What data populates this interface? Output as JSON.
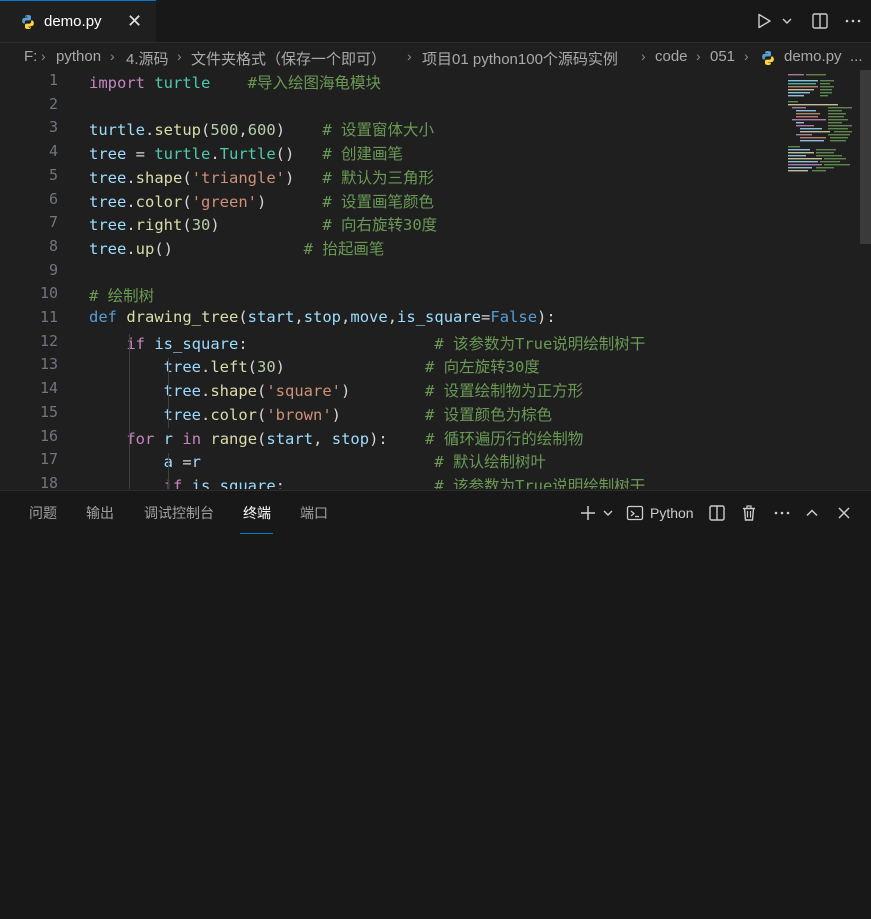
{
  "tab": {
    "title": "demo.py",
    "close": "✕"
  },
  "breadcrumb": [
    "F:",
    "python",
    "4.源码",
    "文件夹格式（保存一个即可）",
    "项目01 python100个源码实例",
    "code",
    "051",
    "demo.py",
    "..."
  ],
  "editor": {
    "line_numbers": [
      "1",
      "2",
      "3",
      "4",
      "5",
      "6",
      "7",
      "8",
      "9",
      "10",
      "11",
      "12",
      "13",
      "14",
      "15",
      "16",
      "17",
      "18"
    ],
    "lines": [
      [
        [
          "kw",
          "import"
        ],
        [
          "t",
          " "
        ],
        [
          "cls",
          "turtle"
        ],
        [
          "t",
          "    "
        ],
        [
          "cm",
          "#导入绘图海龟模块"
        ]
      ],
      [],
      [
        [
          "var",
          "turtle"
        ],
        [
          "t",
          "."
        ],
        [
          "fn",
          "setup"
        ],
        [
          "t",
          "("
        ],
        [
          "num",
          "500"
        ],
        [
          "t",
          ","
        ],
        [
          "num",
          "600"
        ],
        [
          "t",
          ")    "
        ],
        [
          "cm",
          "# 设置窗体大小"
        ]
      ],
      [
        [
          "var",
          "tree"
        ],
        [
          "t",
          " = "
        ],
        [
          "cls",
          "turtle"
        ],
        [
          "t",
          "."
        ],
        [
          "cls",
          "Turtle"
        ],
        [
          "t",
          "()   "
        ],
        [
          "cm",
          "# 创建画笔"
        ]
      ],
      [
        [
          "var",
          "tree"
        ],
        [
          "t",
          "."
        ],
        [
          "fn",
          "shape"
        ],
        [
          "t",
          "("
        ],
        [
          "str",
          "'triangle'"
        ],
        [
          "t",
          ")   "
        ],
        [
          "cm",
          "# 默认为三角形"
        ]
      ],
      [
        [
          "var",
          "tree"
        ],
        [
          "t",
          "."
        ],
        [
          "fn",
          "color"
        ],
        [
          "t",
          "("
        ],
        [
          "str",
          "'green'"
        ],
        [
          "t",
          ")      "
        ],
        [
          "cm",
          "# 设置画笔颜色"
        ]
      ],
      [
        [
          "var",
          "tree"
        ],
        [
          "t",
          "."
        ],
        [
          "fn",
          "right"
        ],
        [
          "t",
          "("
        ],
        [
          "num",
          "30"
        ],
        [
          "t",
          ")           "
        ],
        [
          "cm",
          "# 向右旋转30度"
        ]
      ],
      [
        [
          "var",
          "tree"
        ],
        [
          "t",
          "."
        ],
        [
          "fn",
          "up"
        ],
        [
          "t",
          "()              "
        ],
        [
          "cm",
          "# 抬起画笔"
        ]
      ],
      [],
      [
        [
          "cm",
          "# 绘制树"
        ]
      ],
      [
        [
          "blue",
          "def"
        ],
        [
          "t",
          " "
        ],
        [
          "fn",
          "drawing_tree"
        ],
        [
          "t",
          "("
        ],
        [
          "var",
          "start"
        ],
        [
          "t",
          ","
        ],
        [
          "var",
          "stop"
        ],
        [
          "t",
          ","
        ],
        [
          "var",
          "move"
        ],
        [
          "t",
          ","
        ],
        [
          "var",
          "is_square"
        ],
        [
          "t",
          "="
        ],
        [
          "blue",
          "False"
        ],
        [
          "t",
          "):"
        ]
      ],
      [
        [
          "t",
          "    "
        ],
        [
          "kw",
          "if"
        ],
        [
          "t",
          " "
        ],
        [
          "var",
          "is_square"
        ],
        [
          "t",
          ":                    "
        ],
        [
          "cm",
          "# 该参数为True说明绘制树干"
        ]
      ],
      [
        [
          "t",
          "        "
        ],
        [
          "var",
          "tree"
        ],
        [
          "t",
          "."
        ],
        [
          "fn",
          "left"
        ],
        [
          "t",
          "("
        ],
        [
          "num",
          "30"
        ],
        [
          "t",
          ")               "
        ],
        [
          "cm",
          "# 向左旋转30度"
        ]
      ],
      [
        [
          "t",
          "        "
        ],
        [
          "var",
          "tree"
        ],
        [
          "t",
          "."
        ],
        [
          "fn",
          "shape"
        ],
        [
          "t",
          "("
        ],
        [
          "str",
          "'square'"
        ],
        [
          "t",
          ")        "
        ],
        [
          "cm",
          "# 设置绘制物为正方形"
        ]
      ],
      [
        [
          "t",
          "        "
        ],
        [
          "var",
          "tree"
        ],
        [
          "t",
          "."
        ],
        [
          "fn",
          "color"
        ],
        [
          "t",
          "("
        ],
        [
          "str",
          "'brown'"
        ],
        [
          "t",
          ")         "
        ],
        [
          "cm",
          "# 设置颜色为棕色"
        ]
      ],
      [
        [
          "t",
          "    "
        ],
        [
          "kw",
          "for"
        ],
        [
          "t",
          " "
        ],
        [
          "var",
          "r"
        ],
        [
          "t",
          " "
        ],
        [
          "kw",
          "in"
        ],
        [
          "t",
          " "
        ],
        [
          "fn",
          "range"
        ],
        [
          "t",
          "("
        ],
        [
          "var",
          "start"
        ],
        [
          "t",
          ", "
        ],
        [
          "var",
          "stop"
        ],
        [
          "t",
          "):    "
        ],
        [
          "cm",
          "# 循环遍历行的绘制物"
        ]
      ],
      [
        [
          "t",
          "        "
        ],
        [
          "var",
          "a"
        ],
        [
          "t",
          " ="
        ],
        [
          "var",
          "r"
        ],
        [
          "t",
          "                         "
        ],
        [
          "cm",
          "# 默认绘制树叶"
        ]
      ],
      [
        [
          "t",
          "        "
        ],
        [
          "kw",
          "if"
        ],
        [
          "t",
          " "
        ],
        [
          "var",
          "is_square"
        ],
        [
          "t",
          ":                "
        ],
        [
          "cm",
          "# 该参数为True说明绘制树干"
        ]
      ]
    ]
  },
  "panel": {
    "tabs": [
      "问题",
      "输出",
      "调试控制台",
      "终端",
      "端口"
    ],
    "active_tab": "终端",
    "terminal_profile": "Python"
  },
  "colors": {
    "accent": "#0078d4",
    "keyword": "#c586c0",
    "function": "#dcdcaa",
    "class": "#4ec9b0",
    "variable": "#9cdcfe",
    "number": "#b5cea8",
    "string": "#ce9178",
    "comment": "#6a9955",
    "constant": "#569cd6"
  }
}
